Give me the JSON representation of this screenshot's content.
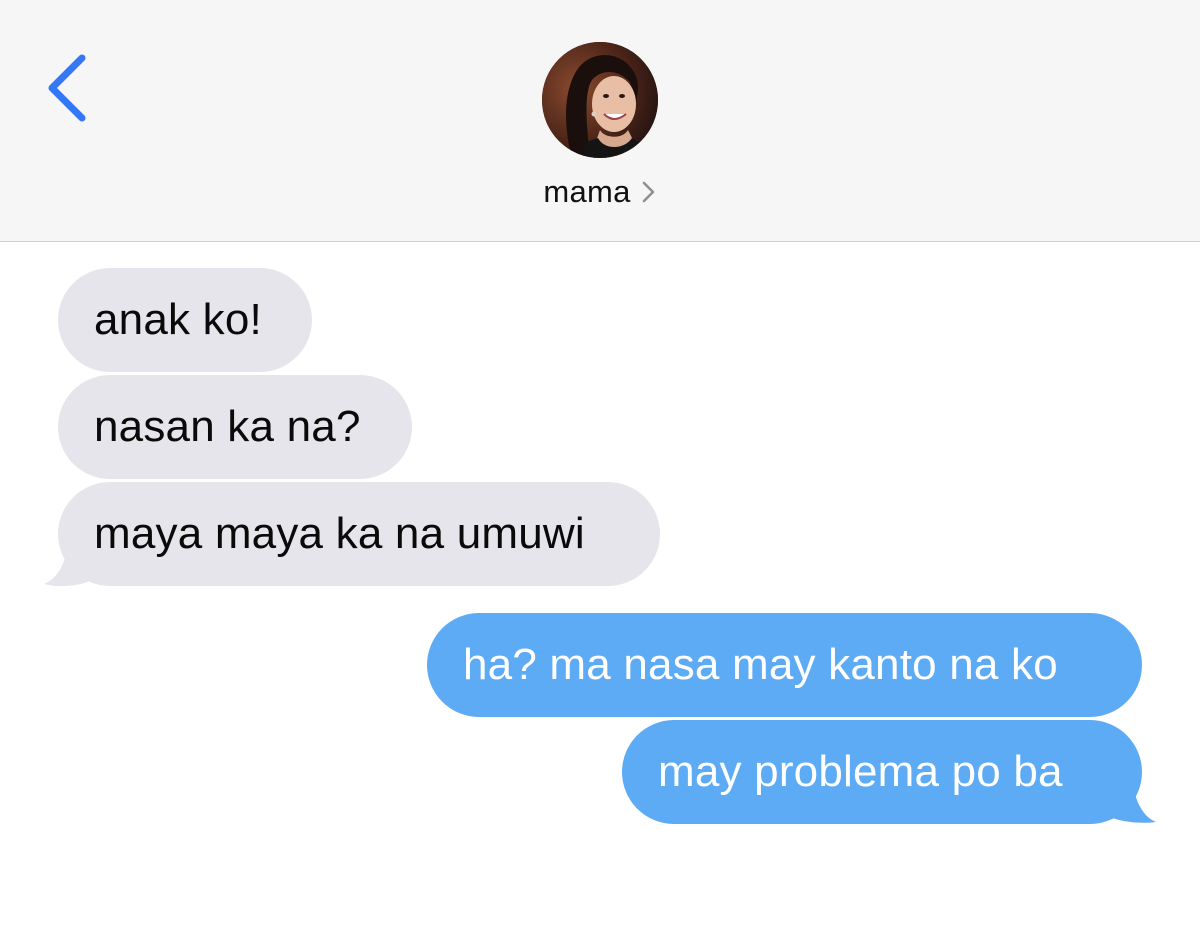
{
  "header": {
    "back_icon": "chevron-left-icon",
    "avatar_icon": "contact-avatar-photo",
    "contact_name": "mama",
    "name_chevron_icon": "chevron-right-icon"
  },
  "messages": [
    {
      "direction": "incoming",
      "text": "anak ko!"
    },
    {
      "direction": "incoming",
      "text": "nasan ka na?"
    },
    {
      "direction": "incoming",
      "text": "maya maya ka na umuwi"
    },
    {
      "direction": "outgoing",
      "text": "ha? ma nasa may kanto na ko"
    },
    {
      "direction": "outgoing",
      "text": "may problema po ba"
    }
  ],
  "colors": {
    "incoming_bubble": "#e6e5eb",
    "outgoing_bubble": "#5eabf5",
    "accent": "#3478f6",
    "header_bg": "#f6f6f7"
  }
}
